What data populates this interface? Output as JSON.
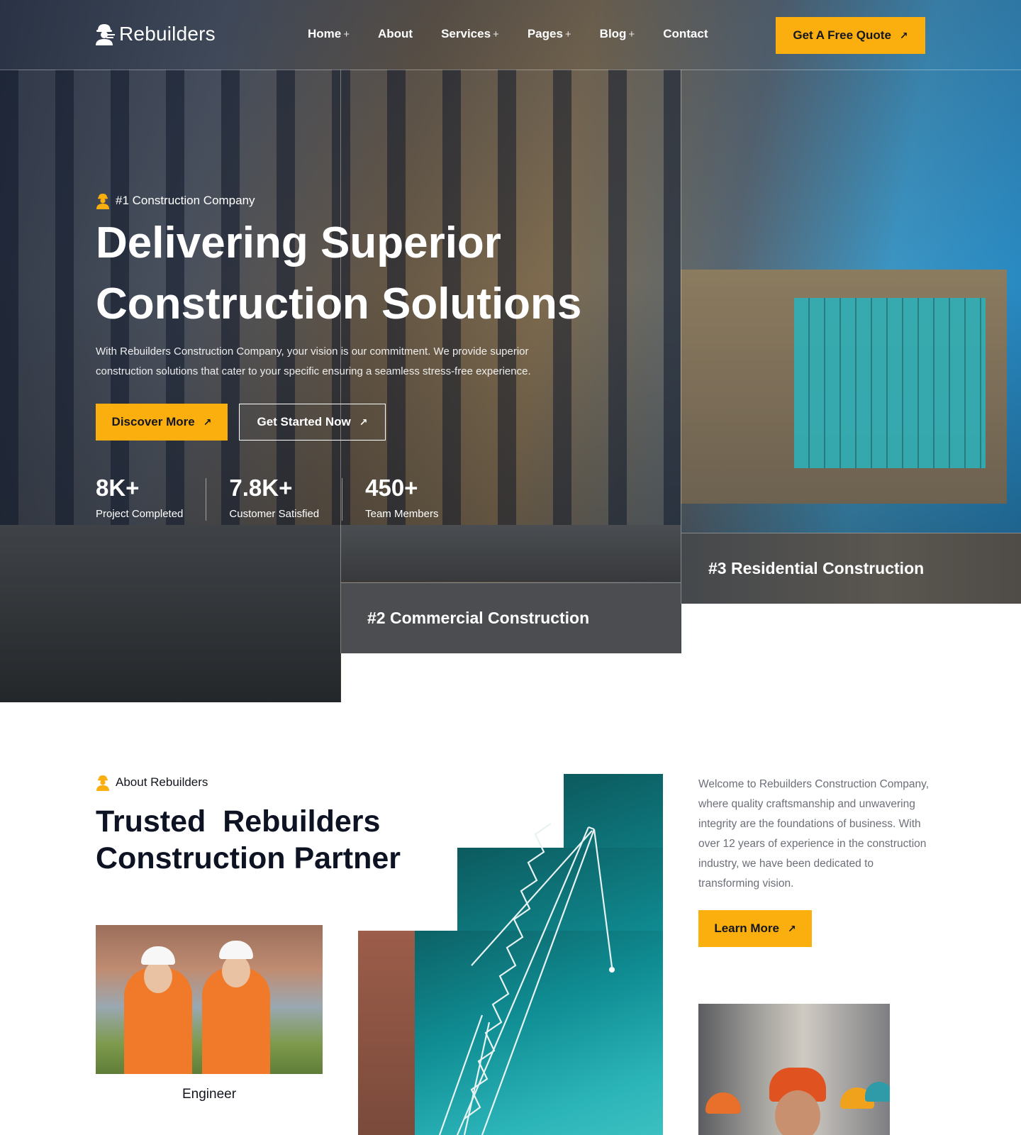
{
  "header": {
    "brand": "Rebuilders",
    "nav": [
      {
        "label": "Home",
        "has_submenu": true
      },
      {
        "label": "About",
        "has_submenu": false
      },
      {
        "label": "Services",
        "has_submenu": true
      },
      {
        "label": "Pages",
        "has_submenu": true
      },
      {
        "label": "Blog",
        "has_submenu": true
      },
      {
        "label": "Contact",
        "has_submenu": false
      }
    ],
    "submenu_symbol": "+",
    "cta_label": "Get A Free Quote"
  },
  "hero": {
    "eyebrow": "#1 Construction Company",
    "title_line1": "Delivering Superior",
    "title_line2": "Construction Solutions",
    "description": "With Rebuilders Construction Company, your vision is our commitment. We provide superior construction solutions that cater to your specific  ensuring a seamless stress-free experience.",
    "primary_button": "Discover More",
    "secondary_button": "Get Started Now",
    "stats": [
      {
        "value": "8K+",
        "label": "Project Completed"
      },
      {
        "value": "7.8K+",
        "label": "Customer Satisfied"
      },
      {
        "value": "450+",
        "label": "Team Members"
      }
    ],
    "panels": [
      {
        "label": "#2 Commercial Construction"
      },
      {
        "label": "#3 Residential Construction"
      }
    ]
  },
  "about": {
    "eyebrow": "About Rebuilders",
    "title_line1": "Trusted  Rebuilders",
    "title_line2": "Construction Partner",
    "engineer_caption": "Engineer",
    "description": "Welcome to Rebuilders Construction Company, where quality craftsmanship and unwavering integrity are the foundations of business. With over 12 years of experience in the construction industry, we have been dedicated to transforming vision.",
    "button": "Learn More"
  },
  "icons": {
    "arrow": "arrow-up-right-icon",
    "worker": "worker-icon",
    "logo": "builder-logo-icon"
  },
  "colors": {
    "accent": "#fbaf0f",
    "dark_text": "#0e1324",
    "muted_text": "#6b6f78",
    "panel_dark": "#4b4d50"
  }
}
